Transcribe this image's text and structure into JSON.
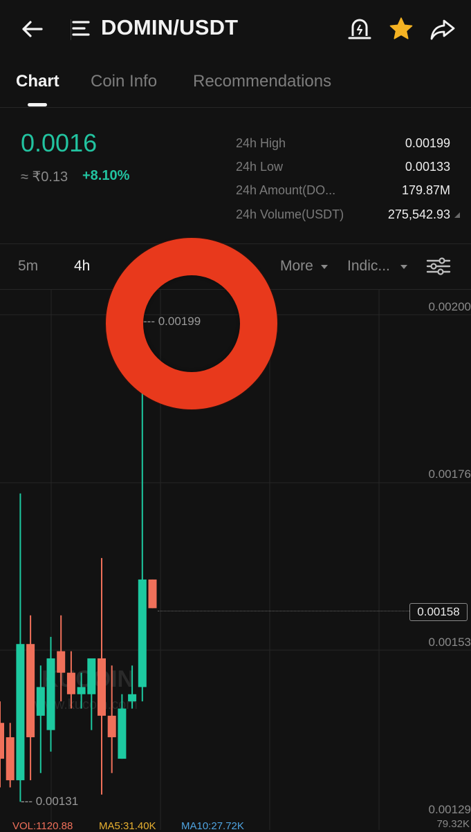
{
  "header": {
    "pair": "DOMIN/USDT",
    "icons": {
      "back": "back-arrow-icon",
      "menu": "menu-list-icon",
      "alert": "price-alert-icon",
      "favorite": "star-icon",
      "share": "share-icon"
    }
  },
  "tabs": [
    {
      "label": "Chart",
      "active": true
    },
    {
      "label": "Coin Info",
      "active": false
    },
    {
      "label": "Recommendations",
      "active": false
    }
  ],
  "ticker": {
    "last_price": "0.0016",
    "fiat_equiv": "≈ ₹0.13",
    "change_pct": "+8.10%",
    "stats": [
      {
        "label": "24h High",
        "value": "0.00199"
      },
      {
        "label": "24h Low",
        "value": "0.00133"
      },
      {
        "label": "24h Amount(DO...",
        "value": "179.87M"
      },
      {
        "label": "24h Volume(USDT)",
        "value": "275,542.93"
      }
    ]
  },
  "intervals": {
    "items": [
      {
        "label": "5m",
        "active": false
      },
      {
        "label": "4h",
        "active": true
      }
    ],
    "more_label": "More",
    "indicators_label": "Indic..."
  },
  "chart": {
    "y_axis_labels": [
      "0.00200",
      "0.00176",
      "0.00153",
      "0.00129"
    ],
    "current_price_label": "0.00158",
    "high_marker": "--- 0.00199",
    "low_marker": "--- 0.00131",
    "watermark_brand": "KUCOIN",
    "watermark_url": "www.kucoin.com",
    "colors": {
      "up": "#1dc9a0",
      "down": "#f0705a",
      "background": "#121212"
    }
  },
  "chart_data": {
    "type": "candlestick",
    "ylim": [
      0.00129,
      0.002
    ],
    "candles": [
      {
        "o": 0.00142,
        "h": 0.00145,
        "l": 0.00133,
        "c": 0.00137
      },
      {
        "o": 0.0014,
        "h": 0.00142,
        "l": 0.00133,
        "c": 0.00134
      },
      {
        "o": 0.00134,
        "h": 0.00174,
        "l": 0.00131,
        "c": 0.00153
      },
      {
        "o": 0.00153,
        "h": 0.00157,
        "l": 0.00134,
        "c": 0.0014
      },
      {
        "o": 0.00143,
        "h": 0.0015,
        "l": 0.00135,
        "c": 0.00147
      },
      {
        "o": 0.00141,
        "h": 0.00154,
        "l": 0.00138,
        "c": 0.00151
      },
      {
        "o": 0.00152,
        "h": 0.00157,
        "l": 0.00145,
        "c": 0.00149
      },
      {
        "o": 0.00149,
        "h": 0.00152,
        "l": 0.00144,
        "c": 0.00146
      },
      {
        "o": 0.00146,
        "h": 0.00149,
        "l": 0.00144,
        "c": 0.00147
      },
      {
        "o": 0.00146,
        "h": 0.00151,
        "l": 0.00141,
        "c": 0.00151
      },
      {
        "o": 0.00151,
        "h": 0.00165,
        "l": 0.00132,
        "c": 0.00143
      },
      {
        "o": 0.00143,
        "h": 0.0015,
        "l": 0.00135,
        "c": 0.0014
      },
      {
        "o": 0.00137,
        "h": 0.00146,
        "l": 0.00137,
        "c": 0.00144
      },
      {
        "o": 0.00145,
        "h": 0.0015,
        "l": 0.00144,
        "c": 0.00146
      },
      {
        "o": 0.00147,
        "h": 0.00199,
        "l": 0.00145,
        "c": 0.00162
      },
      {
        "o": 0.00162,
        "h": 0.00162,
        "l": 0.00158,
        "c": 0.00158
      }
    ]
  },
  "indicators": {
    "vol": "VOL:1120.88",
    "ma5": "MA5:31.40K",
    "ma10": "MA10:27.72K",
    "axis_right": "79.32K",
    "colors": {
      "vol": "#f0705a",
      "ma5": "#e8b030",
      "ma10": "#4fa3e0"
    }
  }
}
